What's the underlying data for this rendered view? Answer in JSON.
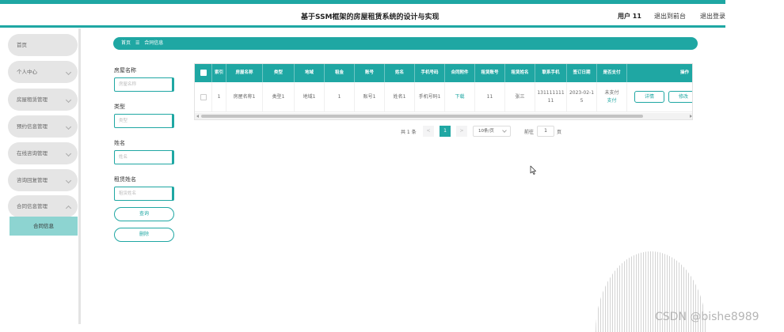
{
  "header": {
    "title": "基于SSM框架的房屋租赁系统的设计与实现",
    "user": "用户 11",
    "links": [
      "退出到前台",
      "退出登录"
    ]
  },
  "sidebar": {
    "items": [
      {
        "label": "首页"
      },
      {
        "label": "个人中心"
      },
      {
        "label": "房屋租赁管理"
      },
      {
        "label": "预约信息管理"
      },
      {
        "label": "在线咨询管理"
      },
      {
        "label": "咨询回复管理"
      },
      {
        "label": "合同信息管理"
      }
    ],
    "sub_item": "合同信息"
  },
  "breadcrumb": {
    "home": "首页",
    "separator": "☰",
    "current": "合同信息"
  },
  "search_form": {
    "fields": [
      {
        "label": "房屋名称",
        "placeholder": "房屋名称"
      },
      {
        "label": "类型",
        "placeholder": "类型"
      },
      {
        "label": "姓名",
        "placeholder": "姓名"
      },
      {
        "label": "租赁姓名",
        "placeholder": "租赁姓名"
      }
    ],
    "query_button": "查询",
    "delete_button": "删除"
  },
  "table": {
    "headers": [
      "索引",
      "房屋名称",
      "类型",
      "地域",
      "租金",
      "账号",
      "姓名",
      "手机号码",
      "合同附件",
      "租赁账号",
      "租赁姓名",
      "联系手机",
      "签订日期",
      "是否支付",
      "操作"
    ],
    "rows": [
      {
        "cells": [
          "1",
          "房屋名称1",
          "类型1",
          "地域1",
          "1",
          "账号1",
          "姓名1",
          "手机号码1",
          "下载",
          "11",
          "张三",
          "13111111111",
          "2023-02-15"
        ],
        "pay_status": "未支付",
        "pay_action": "支付",
        "actions": [
          "详情",
          "修改"
        ]
      }
    ]
  },
  "pagination": {
    "total": "共 1 条",
    "prev": "<",
    "current_page": "1",
    "next": ">",
    "page_size": "10条/页",
    "goto_label": "前往",
    "goto_value": "1",
    "goto_suffix": "页"
  },
  "watermark": "CSDN @bishe8989",
  "colors": {
    "accent": "#1fa7a3",
    "submenu_active": "#8dd4d1"
  }
}
